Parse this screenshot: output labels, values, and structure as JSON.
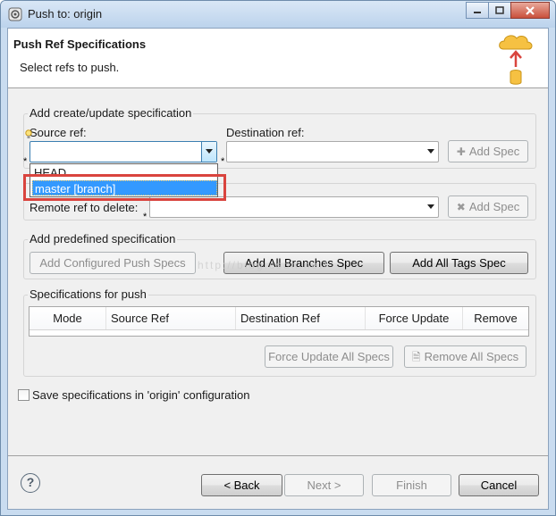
{
  "window": {
    "title": "Push to: origin",
    "minimize_icon": "minimize-icon",
    "maximize_icon": "maximize-icon",
    "close_icon": "close-icon"
  },
  "header": {
    "title": "Push Ref Specifications",
    "description": "Select refs to push.",
    "icon": "push-cloud-icon"
  },
  "add_spec_group": {
    "label": "Add create/update specification",
    "source_label": "Source ref:",
    "source_value": "",
    "destination_label": "Destination ref:",
    "destination_value": "",
    "add_spec_label": "Add Spec",
    "required_marker": "*"
  },
  "source_dropdown": {
    "options": [
      {
        "label": "HEAD",
        "selected": false
      },
      {
        "label": "master [branch]",
        "selected": true
      }
    ]
  },
  "delete_group": {
    "remote_ref_label": "Remote ref to delete:",
    "remote_ref_value": "",
    "add_spec_label": "Add Spec",
    "required_marker": "*"
  },
  "predefined_group": {
    "label": "Add predefined specification",
    "buttons": [
      {
        "label": "Add Configured Push Specs",
        "enabled": false
      },
      {
        "label": "Add All Branches Spec",
        "enabled": true
      },
      {
        "label": "Add All Tags Spec",
        "enabled": true
      }
    ]
  },
  "specs_group": {
    "label": "Specifications for push",
    "columns": [
      "Mode",
      "Source Ref",
      "Destination Ref",
      "Force Update",
      "Remove"
    ],
    "rows": [],
    "force_update_all_label": "Force Update All Specs",
    "remove_all_label": "Remove All Specs"
  },
  "save_option": {
    "label": "Save specifications in 'origin' configuration",
    "checked": false
  },
  "footer": {
    "help_label": "?",
    "back_label": "< Back",
    "next_label": "Next >",
    "finish_label": "Finish",
    "cancel_label": "Cancel"
  },
  "colors": {
    "selection": "#3399ff",
    "callout": "#d9443e",
    "dialog_bg": "#f0f0f0"
  }
}
